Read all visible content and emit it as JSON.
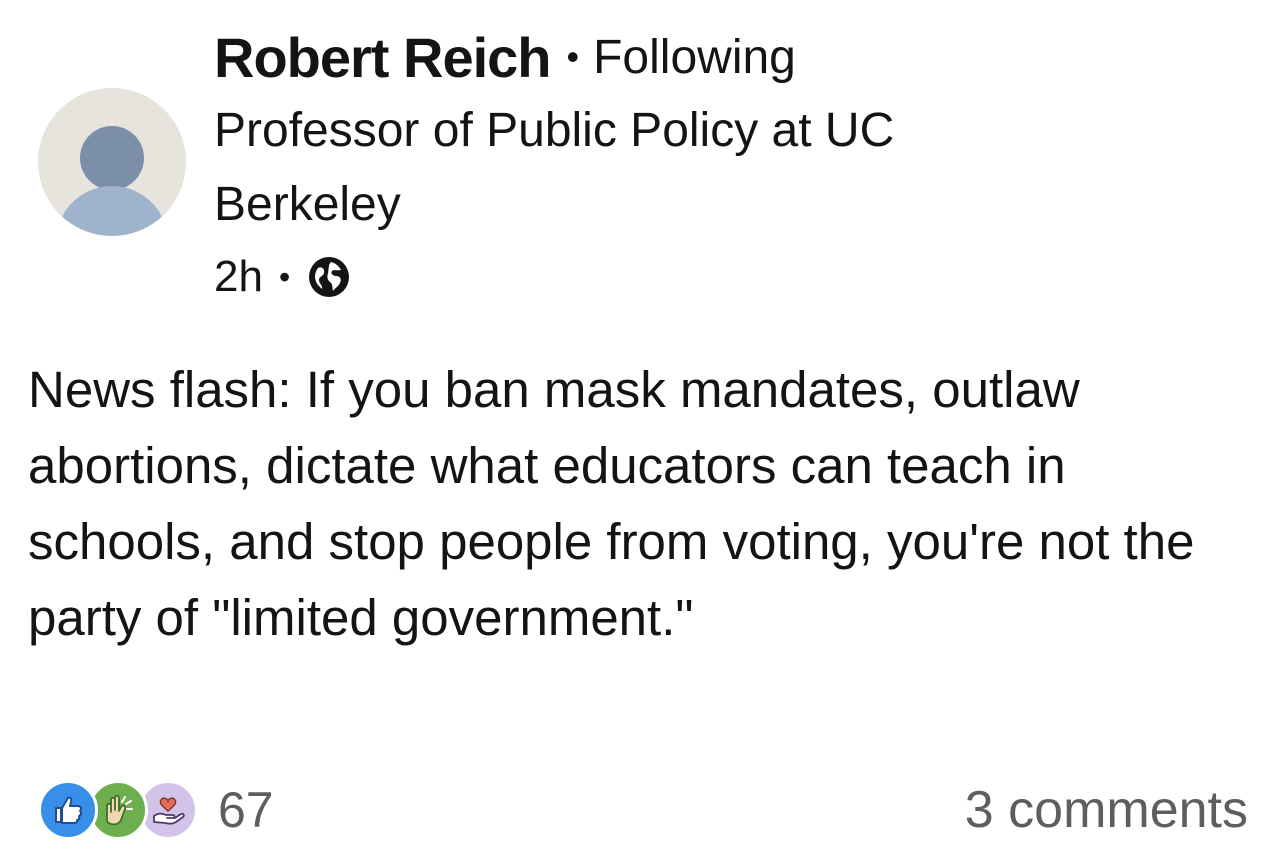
{
  "author": {
    "name": "Robert Reich",
    "separator": "•",
    "follow_status": "Following",
    "headline": "Professor of Public Policy at UC Berkeley",
    "avatar_icon": "default-avatar-icon"
  },
  "meta": {
    "time": "2h",
    "separator": "•",
    "visibility_icon": "globe-icon"
  },
  "post": {
    "text": "News flash: If you ban mask mandates, outlaw abortions, dictate what educators can teach in schools, and stop people from voting, you're not the party of \"limited government.\""
  },
  "social": {
    "reaction_icons": [
      "like-icon",
      "celebrate-icon",
      "support-icon"
    ],
    "reaction_count": "67",
    "comments": "3 comments"
  },
  "colors": {
    "like": "#378fe9",
    "celebrate": "#6dae4f",
    "support": "#d4c3e8",
    "secondary_text": "#5e5e5e"
  }
}
